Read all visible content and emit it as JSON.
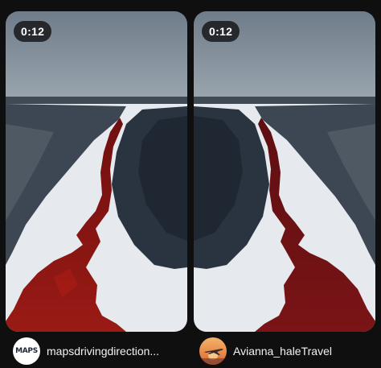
{
  "videos": [
    {
      "duration": "0:12",
      "username": "mapsdrivingdirection...",
      "avatar_icon": "maps-driving-logo",
      "avatar_text": "MAPS"
    },
    {
      "duration": "0:12",
      "username": "Avianna_haleTravel",
      "avatar_icon": "airplane-sunset-avatar"
    }
  ],
  "colors": {
    "background": "#0f0f10",
    "river": "#8e1414",
    "snow": "#e9edf2",
    "sky": "#7f8c98"
  }
}
